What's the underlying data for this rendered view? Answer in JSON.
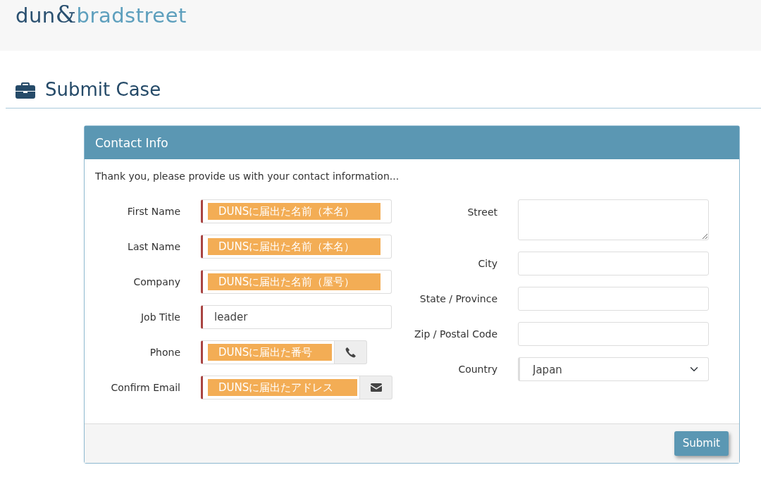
{
  "logo": {
    "left": "dun",
    "mark": "&",
    "right": "bradstreet"
  },
  "page_title": "Submit Case",
  "panel": {
    "title": "Contact Info",
    "intro": "Thank you, please provide us with your contact information...",
    "left_fields": [
      {
        "label": "First Name",
        "kind": "text",
        "value": "DUNSに届出た名前（本名）",
        "required": true,
        "highlighted": true
      },
      {
        "label": "Last Name",
        "kind": "text",
        "value": "DUNSに届出た名前（本名）",
        "required": true,
        "highlighted": true
      },
      {
        "label": "Company",
        "kind": "text",
        "value": "DUNSに届出た名前（屋号）",
        "required": true,
        "highlighted": true
      },
      {
        "label": "Job Title",
        "kind": "text",
        "value": "leader",
        "required": true,
        "highlighted": false
      },
      {
        "label": "Phone",
        "kind": "phone",
        "value": "DUNSに届出た番号",
        "required": true,
        "highlighted": true
      },
      {
        "label": "Confirm Email",
        "kind": "email",
        "value": "DUNSに届出たアドレス",
        "required": true,
        "highlighted": true
      }
    ],
    "right_fields": [
      {
        "label": "Street",
        "kind": "textarea",
        "required": false
      },
      {
        "label": "City",
        "kind": "text",
        "required": false
      },
      {
        "label": "State / Province",
        "kind": "text",
        "required": false
      },
      {
        "label": "Zip / Postal Code",
        "kind": "text",
        "required": false
      },
      {
        "label": "Country",
        "kind": "select",
        "value": "Japan",
        "required": true
      }
    ],
    "submit": "Submit"
  }
}
